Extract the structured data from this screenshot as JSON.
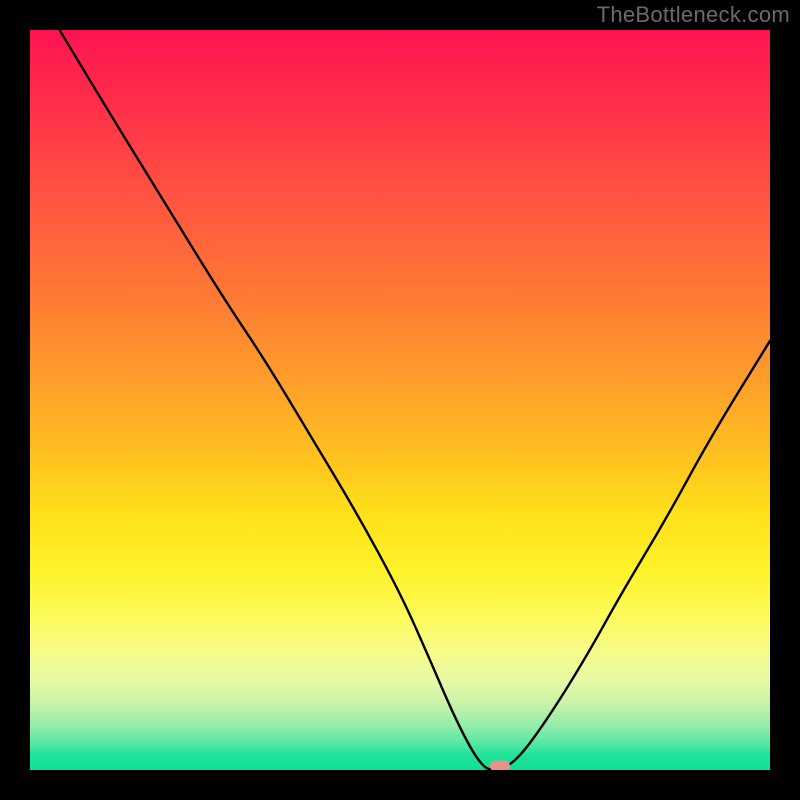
{
  "watermark": "TheBottleneck.com",
  "colors": {
    "page_bg": "#000000",
    "curve_stroke": "#000000",
    "marker_fill": "#e6948a",
    "gradient_top": "#ff1351",
    "gradient_bottom": "#0fe096"
  },
  "chart_data": {
    "type": "line",
    "title": "",
    "xlabel": "",
    "ylabel": "",
    "xlim": [
      0,
      100
    ],
    "ylim": [
      0,
      100
    ],
    "grid": false,
    "legend": false,
    "notes": "V-shaped black curve over a vertical red→green gradient. Minimum near x≈62 at y≈0. Left arm starts at top-left (x≈4, y=100), right arm rises to x=100 at y≈58. Small rounded marker sits at the trough (~x 63.5, y 0).",
    "series": [
      {
        "name": "curve",
        "x": [
          4,
          10,
          18,
          26,
          32,
          38,
          44,
          50,
          54,
          57,
          59.5,
          61,
          62,
          63.5,
          66,
          70,
          75,
          80,
          86,
          92,
          100
        ],
        "y": [
          100,
          90,
          77,
          64,
          55,
          45,
          35,
          24,
          15,
          8,
          3,
          0.8,
          0,
          0,
          1.5,
          7,
          15,
          24,
          34,
          45,
          58
        ]
      }
    ],
    "marker": {
      "x": 63.5,
      "y": 0
    }
  }
}
